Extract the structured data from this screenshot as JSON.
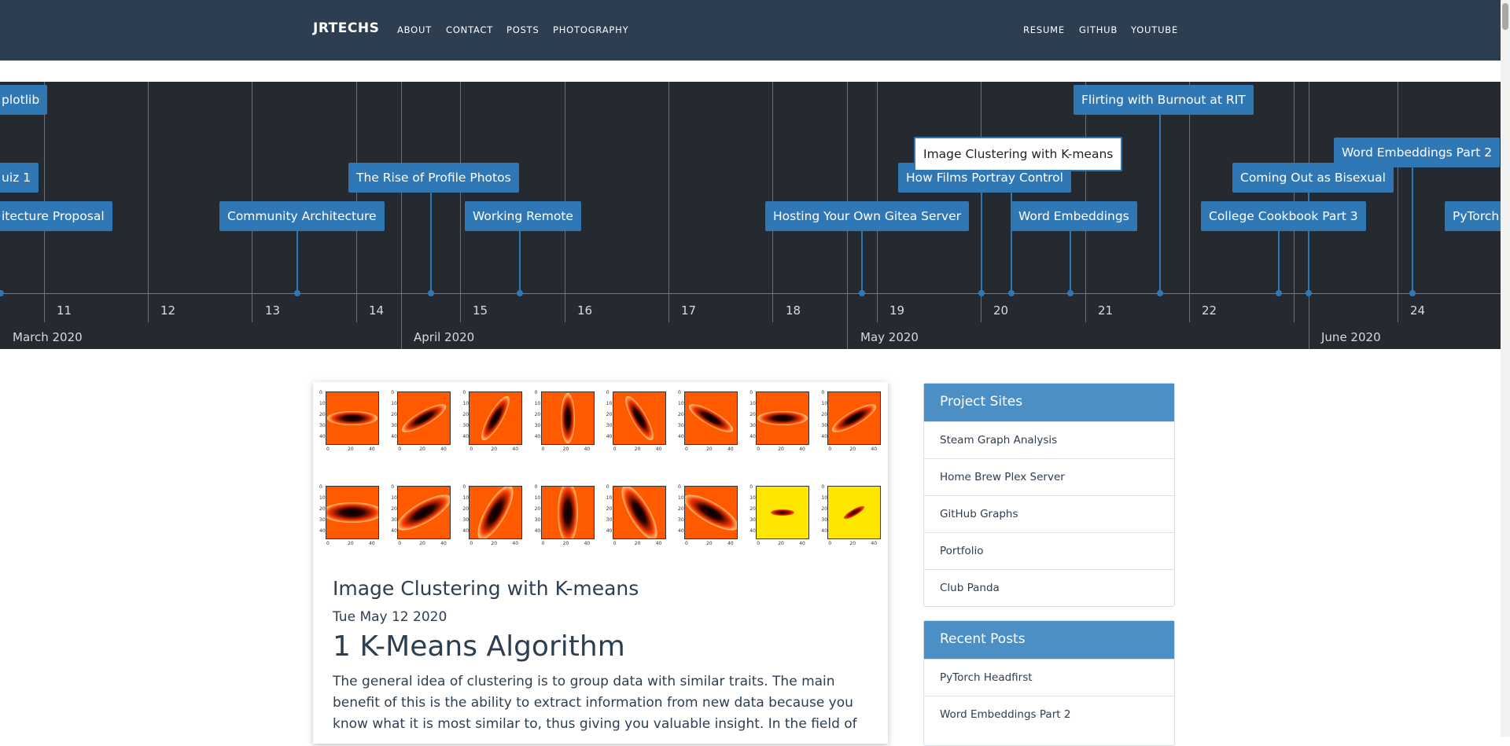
{
  "nav": {
    "brand": "JRTECHS",
    "left_links": [
      "ABOUT",
      "CONTACT",
      "POSTS",
      "PHOTOGRAPHY"
    ],
    "right_links": [
      "RESUME",
      "GITHUB",
      "YOUTUBE"
    ]
  },
  "timeline": {
    "days": [
      "11",
      "12",
      "13",
      "14",
      "15",
      "16",
      "17",
      "18",
      "19",
      "20",
      "21",
      "22",
      "24"
    ],
    "months": [
      "March 2020",
      "April 2020",
      "May 2020",
      "June 2020"
    ],
    "items": [
      {
        "label": "plotlib"
      },
      {
        "label": "uiz 1"
      },
      {
        "label": "itecture Proposal"
      },
      {
        "label": "Community Architecture"
      },
      {
        "label": "The Rise of Profile Photos"
      },
      {
        "label": "Working Remote"
      },
      {
        "label": "Hosting Your Own Gitea Server"
      },
      {
        "label": "How Films Portray Control"
      },
      {
        "label": "Image Clustering with K-means"
      },
      {
        "label": "Word Embeddings"
      },
      {
        "label": "Flirting with Burnout at RIT"
      },
      {
        "label": "Coming Out as Bisexual"
      },
      {
        "label": "College Cookbook Part 3"
      },
      {
        "label": "Word Embeddings Part 2"
      },
      {
        "label": "PyTorch"
      }
    ]
  },
  "post": {
    "title": "Image Clustering with K-means",
    "date": "Tue May 12 2020",
    "heading": "1 K-Means Algorithm",
    "body": "The general idea of clustering is to group data with similar traits. The main benefit of this is the ability to extract information from new data because you know what it is most similar to, thus giving you valuable insight. In the field of",
    "plot_ticks_y": [
      "0",
      "10",
      "20",
      "30",
      "40"
    ],
    "plot_ticks_x": [
      "0",
      "20",
      "40"
    ]
  },
  "sidebar": {
    "project_sites": {
      "title": "Project Sites",
      "items": [
        "Steam Graph Analysis",
        "Home Brew Plex Server",
        "GitHub Graphs",
        "Portfolio",
        "Club Panda"
      ]
    },
    "recent_posts": {
      "title": "Recent Posts",
      "items": [
        "PyTorch Headfirst",
        "Word Embeddings Part 2"
      ]
    }
  },
  "colors": {
    "navbar": "#2c3e50",
    "timeline_bg": "#252a31",
    "timeline_item": "#2f78b5",
    "panel_header": "#4b8fc4"
  }
}
